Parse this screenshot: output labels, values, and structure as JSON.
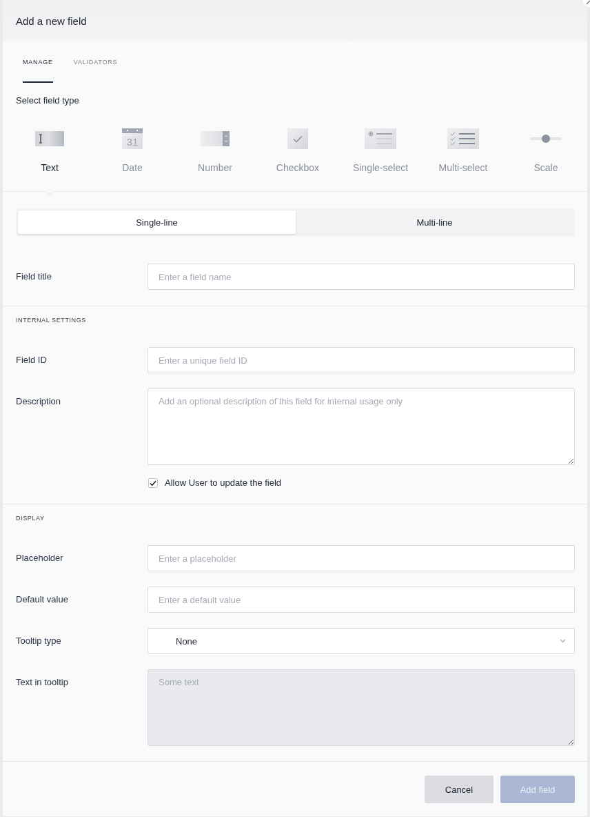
{
  "dialog": {
    "title": "Add a new field"
  },
  "tabs": [
    {
      "label": "MANAGE",
      "selected": true
    },
    {
      "label": "VALIDATORS",
      "selected": false
    }
  ],
  "field_type": {
    "heading": "Select field type",
    "options": [
      {
        "kind": "text",
        "label": "Text",
        "selected": true
      },
      {
        "kind": "date",
        "label": "Date",
        "selected": false,
        "icon_text": "31"
      },
      {
        "kind": "number",
        "label": "Number",
        "selected": false
      },
      {
        "kind": "checkbox",
        "label": "Checkbox",
        "selected": false
      },
      {
        "kind": "single_select",
        "label": "Single-select",
        "selected": false
      },
      {
        "kind": "multi_select",
        "label": "Multi-select",
        "selected": false
      },
      {
        "kind": "scale",
        "label": "Scale",
        "selected": false
      }
    ]
  },
  "line_mode": [
    {
      "label": "Single-line",
      "selected": true
    },
    {
      "label": "Multi-line",
      "selected": false
    }
  ],
  "sections": [
    {
      "rows": [
        {
          "kind": "input",
          "label": "Field title",
          "placeholder": "Enter a field name"
        }
      ]
    },
    {
      "heading": "INTERNAL SETTINGS",
      "rows": [
        {
          "kind": "input",
          "label": "Field ID",
          "placeholder": "Enter a unique field ID"
        },
        {
          "kind": "textarea",
          "label": "Description",
          "placeholder": "Add an optional description of this field for internal usage only",
          "disabled": false
        },
        {
          "kind": "checkbox",
          "label": "Allow User to update the field",
          "checked": true
        }
      ]
    },
    {
      "heading": "DISPLAY",
      "rows": [
        {
          "kind": "input",
          "label": "Placeholder",
          "placeholder": "Enter a placeholder"
        },
        {
          "kind": "input",
          "label": "Default value",
          "placeholder": "Enter a default value"
        },
        {
          "kind": "select",
          "label": "Tooltip type",
          "value": "None"
        },
        {
          "kind": "textarea",
          "label": "Text in tooltip",
          "placeholder": "Some text",
          "disabled": true
        }
      ]
    }
  ],
  "footer": {
    "buttons": [
      {
        "kind": "secondary",
        "label": "Cancel",
        "disabled": false
      },
      {
        "kind": "primary",
        "label": "Add field",
        "disabled": true
      }
    ]
  }
}
